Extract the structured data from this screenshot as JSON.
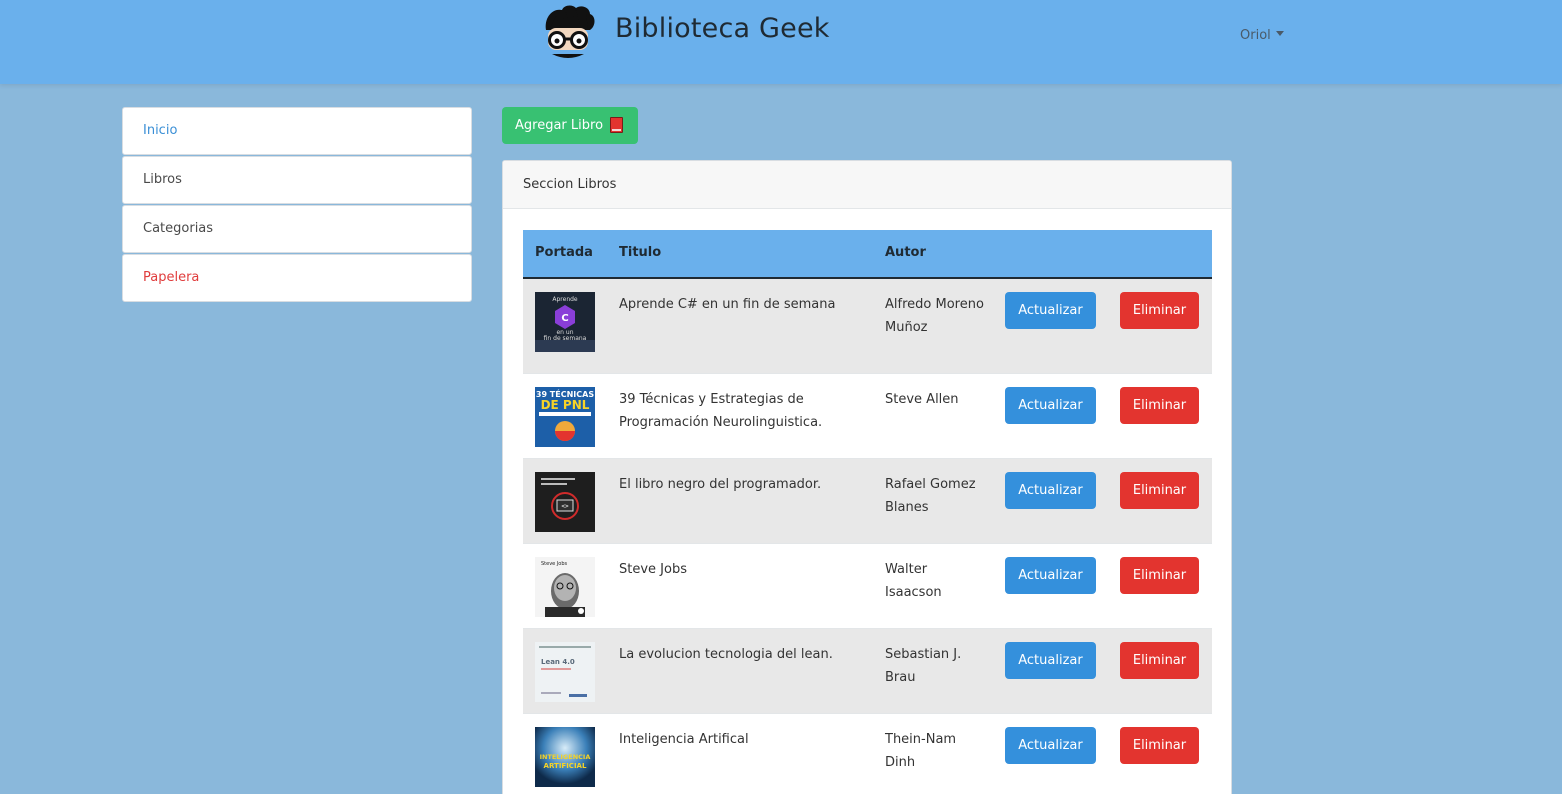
{
  "navbar": {
    "brand": "Biblioteca Geek",
    "user": "Oriol",
    "logo_icon": "geek-glasses-logo"
  },
  "sidebar": {
    "items": [
      {
        "label": "Inicio",
        "state": "active"
      },
      {
        "label": "Libros",
        "state": "normal"
      },
      {
        "label": "Categorias",
        "state": "normal"
      },
      {
        "label": "Papelera",
        "state": "danger"
      }
    ]
  },
  "actions": {
    "add_label": "Agregar Libro",
    "add_icon": "red-book-icon"
  },
  "section": {
    "title": "Seccion Libros"
  },
  "table": {
    "headers": [
      "Portada",
      "Titulo",
      "Autor"
    ],
    "update_label": "Actualizar",
    "delete_label": "Eliminar",
    "rows": [
      {
        "title": "Aprende C# en un fin de semana",
        "author": "Alfredo Moreno Muñoz",
        "cover": "csharp-cover"
      },
      {
        "title": "39 Técnicas y Estrategias de Programación Neurolinguistica.",
        "author": "Steve Allen",
        "cover": "pnl-cover"
      },
      {
        "title": "El libro negro del programador.",
        "author": "Rafael Gomez Blanes",
        "cover": "libro-negro-cover"
      },
      {
        "title": "Steve Jobs",
        "author": "Walter Isaacson",
        "cover": "steve-jobs-cover"
      },
      {
        "title": "La evolucion tecnologia del lean.",
        "author": "Sebastian J. Brau",
        "cover": "lean-cover"
      },
      {
        "title": "Inteligencia Artifical",
        "author": "Thein-Nam Dinh",
        "cover": "ia-cover"
      }
    ]
  },
  "colors": {
    "navbar": "#6ab0ec",
    "background": "#8ab8db",
    "primary": "#3490dc",
    "danger": "#e3342f",
    "success": "#38c172"
  },
  "cover_art": {
    "csharp": {
      "line1": "Aprende",
      "line2": "en un",
      "line3": "fin de semana"
    },
    "pnl": {
      "line1": "39 TÉCNICAS",
      "line2": "DE PNL"
    },
    "jobs": {
      "name": "Steve Jobs"
    },
    "lean": {
      "line1": "Lean 4.0"
    },
    "ia": {
      "line1": "INTELIGENCIA",
      "line2": "ARTIFICIAL"
    }
  }
}
